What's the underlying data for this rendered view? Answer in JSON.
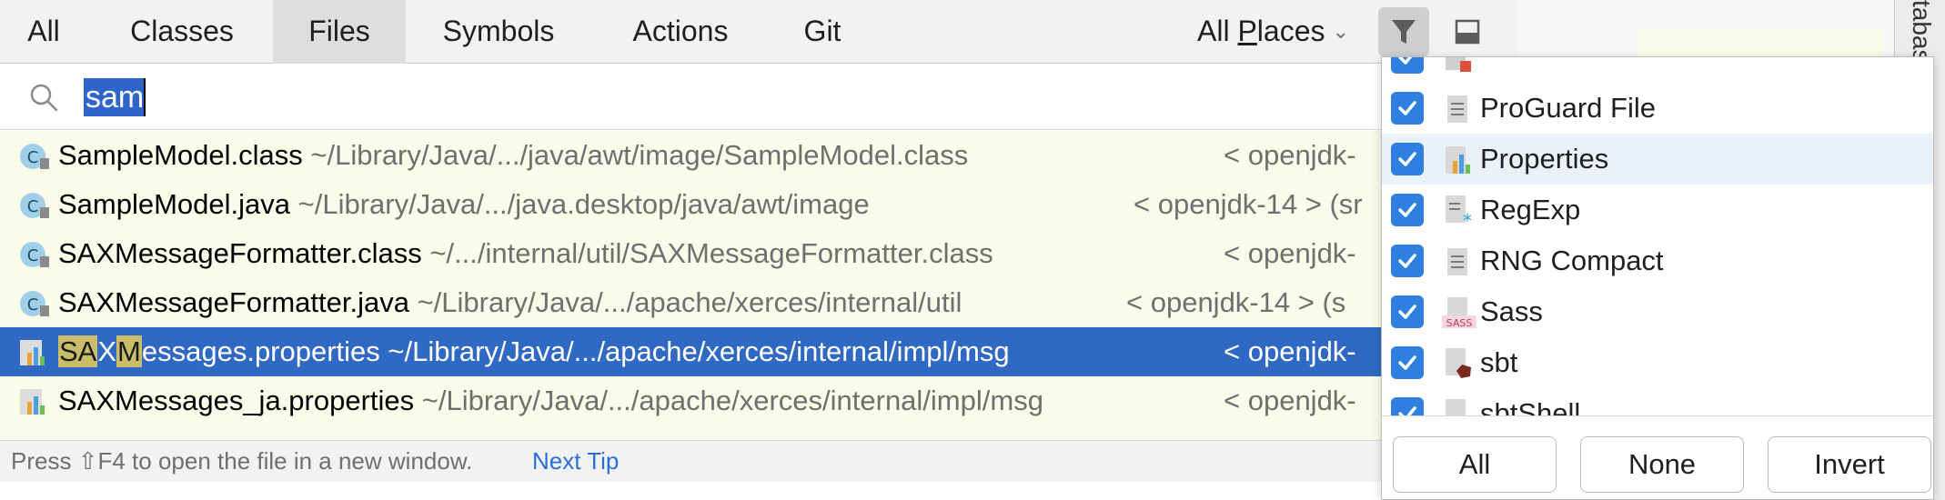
{
  "tabs": [
    {
      "label": "All"
    },
    {
      "label": "Classes"
    },
    {
      "label": "Files"
    },
    {
      "label": "Symbols"
    },
    {
      "label": "Actions"
    },
    {
      "label": "Git"
    }
  ],
  "scope": {
    "label_pre": "All ",
    "label_u": "P",
    "label_post": "laces"
  },
  "search": {
    "value": "sam"
  },
  "results": [
    {
      "name": "SampleModel.class",
      "path": " ~/Library/Java/.../java/awt/image/SampleModel.class",
      "location": "< openjdk-",
      "icon": "class-file-icon"
    },
    {
      "name": "SampleModel.java",
      "path": " ~/Library/Java/.../java.desktop/java/awt/image",
      "location": "< openjdk-14 > (sr",
      "icon": "class-file-icon"
    },
    {
      "name": "SAXMessageFormatter.class",
      "path": " ~/.../internal/util/SAXMessageFormatter.class",
      "location": "< openjdk-",
      "icon": "class-file-icon"
    },
    {
      "name": "SAXMessageFormatter.java",
      "path": " ~/Library/Java/.../apache/xerces/internal/util",
      "location": "< openjdk-14 > (s",
      "icon": "class-file-icon"
    },
    {
      "name_parts": [
        "SA",
        "X",
        "M",
        "essages.properties"
      ],
      "path": " ~/Library/Java/.../apache/xerces/internal/impl/msg",
      "location": "< openjdk-",
      "icon": "properties-file-icon",
      "selected": true
    },
    {
      "name": "SAXMessages_ja.properties",
      "path": " ~/Library/Java/.../apache/xerces/internal/impl/msg",
      "location": "< openjdk-",
      "icon": "properties-file-icon"
    }
  ],
  "status": {
    "text": "Press ⇧F4 to open the file in a new window.",
    "next_tip": "Next Tip"
  },
  "filter": {
    "items": [
      {
        "label": "",
        "icon": "file-type-icon"
      },
      {
        "label": "ProGuard File",
        "icon": "text-file-icon"
      },
      {
        "label": "Properties",
        "icon": "properties-file-icon"
      },
      {
        "label": "RegExp",
        "icon": "regexp-file-icon"
      },
      {
        "label": "RNG Compact",
        "icon": "text-file-icon"
      },
      {
        "label": "Sass",
        "icon": "sass-file-icon"
      },
      {
        "label": "sbt",
        "icon": "sbt-file-icon"
      },
      {
        "label": "sbtShell",
        "icon": "sbt-file-icon"
      }
    ],
    "buttons": {
      "all": "All",
      "none": "None",
      "invert": "Invert"
    }
  },
  "background": {
    "side_text": "tabas"
  },
  "colors": {
    "accent": "#2f69c4",
    "checkbox": "#2f7fe0",
    "highlight": "#c9bd6a",
    "link": "#2a6fd6",
    "results_bg": "#fbfbe9"
  }
}
